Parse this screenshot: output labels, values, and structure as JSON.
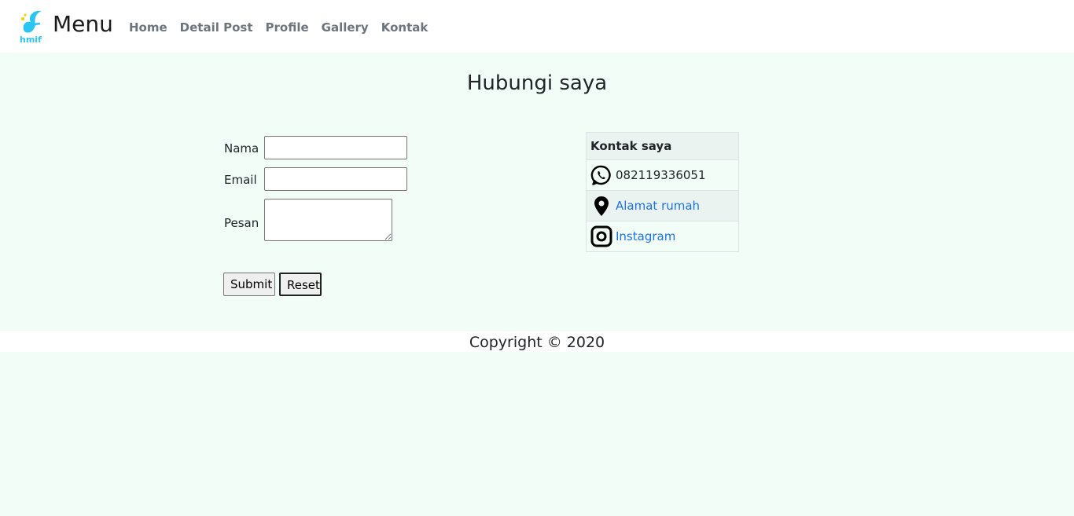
{
  "navbar": {
    "brand": "Menu",
    "logo_text": "hmif",
    "links": [
      {
        "label": "Home"
      },
      {
        "label": "Detail Post"
      },
      {
        "label": "Profile"
      },
      {
        "label": "Gallery"
      },
      {
        "label": "Kontak"
      }
    ]
  },
  "main": {
    "title": "Hubungi saya",
    "form": {
      "name_label": "Nama",
      "name_value": "",
      "email_label": "Email",
      "email_value": "",
      "message_label": "Pesan",
      "message_value": "",
      "submit_label": "Submit",
      "reset_label": "Reset"
    },
    "contact": {
      "header": "Kontak saya",
      "rows": [
        {
          "icon": "whatsapp-icon",
          "text": "082119336051",
          "is_link": false
        },
        {
          "icon": "map-pin-icon",
          "text": "Alamat rumah",
          "is_link": true
        },
        {
          "icon": "instagram-icon",
          "text": "Instagram",
          "is_link": true
        }
      ]
    }
  },
  "footer": {
    "text": "Copyright © 2020"
  },
  "colors": {
    "background": "#f3fdf8",
    "navbar_bg": "#ffffff",
    "nav_link": "#6c757d",
    "link": "#1a73e8",
    "logo_blue": "#29c6f2",
    "logo_yellow": "#f5d000"
  }
}
